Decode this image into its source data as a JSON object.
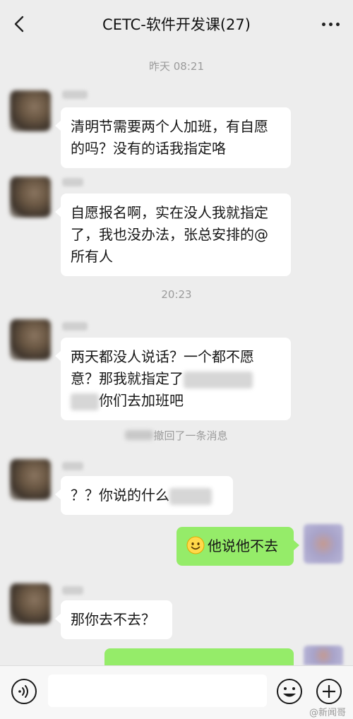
{
  "header": {
    "title": "CETC-软件开发课(27)",
    "back_icon": "chevron-left-icon",
    "more_icon": "more-dots-icon"
  },
  "messages": {
    "time1": "昨天 08:21",
    "msg1": "清明节需要两个人加班，有自愿的吗？没有的话我指定咯",
    "msg2": "自愿报名啊，实在没人我就指定了，我也没办法，张总安排的@所有人",
    "time2": "20:23",
    "msg3_part1": "两天都没人说话？一个都不愿意？那我就指定了",
    "msg3_part2": "你们去加班吧",
    "recall": "撤回了一条消息",
    "msg4": "？？你说的什么",
    "msg5": "他说他不去",
    "msg6": "那你去不去？"
  },
  "input_bar": {
    "voice_icon": "voice-icon",
    "emoji_icon": "emoji-icon",
    "plus_icon": "plus-icon",
    "input_value": ""
  },
  "watermark": "@新闻哥",
  "colors": {
    "background": "#ededed",
    "bubble_white": "#ffffff",
    "bubble_green": "#95ec69",
    "timestamp_gray": "#9b9b9b"
  }
}
